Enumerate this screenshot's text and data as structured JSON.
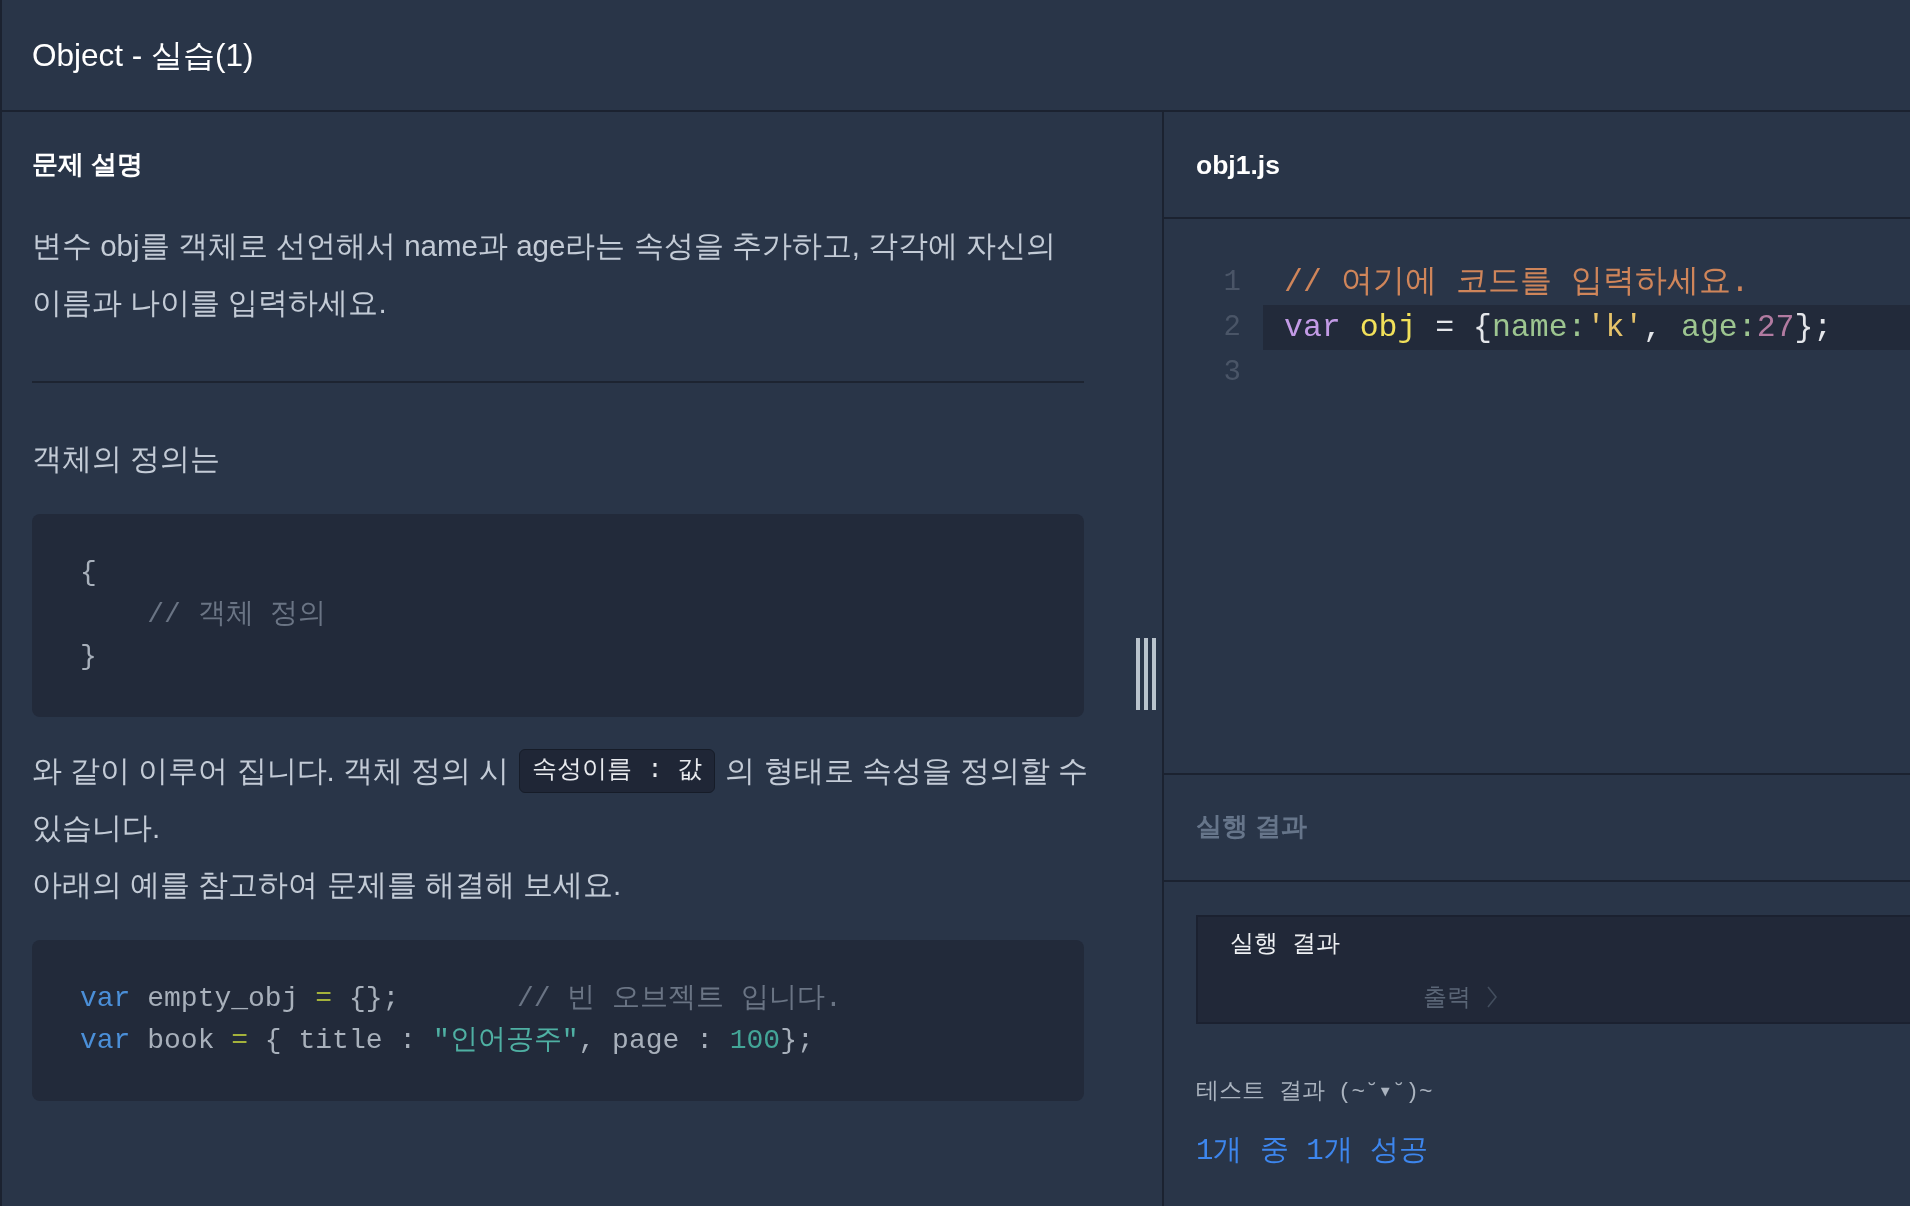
{
  "header": {
    "title": "Object - 실습(1)"
  },
  "problem": {
    "heading": "문제 설명",
    "description": "변수 obj를 객체로 선언해서 name과 age라는 속성을 추가하고, 각각에 자신의 이름과 나이를 입력하세요.",
    "content": [
      {
        "kind": "paragraph",
        "lines": [
          [
            {
              "kind": "text",
              "text": "객체의 정의는"
            }
          ]
        ]
      },
      {
        "kind": "code",
        "lines": [
          [
            {
              "kind": "plain",
              "text": "{"
            }
          ],
          [
            {
              "kind": "comment",
              "text": "    // 객체 정의"
            }
          ],
          [
            {
              "kind": "plain",
              "text": "}"
            }
          ]
        ]
      },
      {
        "kind": "paragraph",
        "lines": [
          [
            {
              "kind": "text",
              "text": "와 같이 이루어 집니다. 객체 정의 시"
            },
            {
              "kind": "inline_code",
              "text": "속성이름 : 값"
            },
            {
              "kind": "text",
              "text": "의 형태로 속성을 정의할 수"
            }
          ],
          [
            {
              "kind": "text",
              "text": "있습니다."
            }
          ],
          [
            {
              "kind": "text",
              "text": "아래의 예를 참고하여 문제를 해결해 보세요."
            }
          ]
        ]
      },
      {
        "kind": "code",
        "lines": [
          [
            {
              "kind": "keyword",
              "text": "var"
            },
            {
              "kind": "plain",
              "text": " empty_obj "
            },
            {
              "kind": "operator",
              "text": "="
            },
            {
              "kind": "plain",
              "text": " {};       "
            },
            {
              "kind": "comment",
              "text": "// 빈 오브젝트 입니다."
            }
          ],
          [
            {
              "kind": "keyword",
              "text": "var"
            },
            {
              "kind": "plain",
              "text": " book "
            },
            {
              "kind": "operator",
              "text": "="
            },
            {
              "kind": "plain",
              "text": " { title : "
            },
            {
              "kind": "string",
              "text": "\"인어공주\""
            },
            {
              "kind": "plain",
              "text": ", page : "
            },
            {
              "kind": "number",
              "text": "100"
            },
            {
              "kind": "plain",
              "text": "};"
            }
          ]
        ]
      }
    ]
  },
  "editor": {
    "filename": "obj1.js",
    "lines": [
      {
        "number": "1",
        "active": false,
        "tokens": [
          {
            "kind": "comment",
            "text": "// 여기에 코드를 입력하세요."
          }
        ]
      },
      {
        "number": "2",
        "active": true,
        "tokens": [
          {
            "kind": "keyword",
            "text": "var "
          },
          {
            "kind": "variable",
            "text": "obj"
          },
          {
            "kind": "plain",
            "text": " = {"
          },
          {
            "kind": "property",
            "text": "name:"
          },
          {
            "kind": "string",
            "text": "'k'"
          },
          {
            "kind": "plain",
            "text": ", "
          },
          {
            "kind": "property",
            "text": "age:"
          },
          {
            "kind": "number",
            "text": "27"
          },
          {
            "kind": "plain",
            "text": "};"
          }
        ]
      },
      {
        "number": "3",
        "active": false
      }
    ]
  },
  "result": {
    "heading": "실행 결과",
    "output_panel": {
      "title": "실행 결과",
      "output_label": "출력"
    },
    "test_label": "테스트 결과 (~˘▾˘)~",
    "summary": "1개 중 1개 성공"
  }
}
